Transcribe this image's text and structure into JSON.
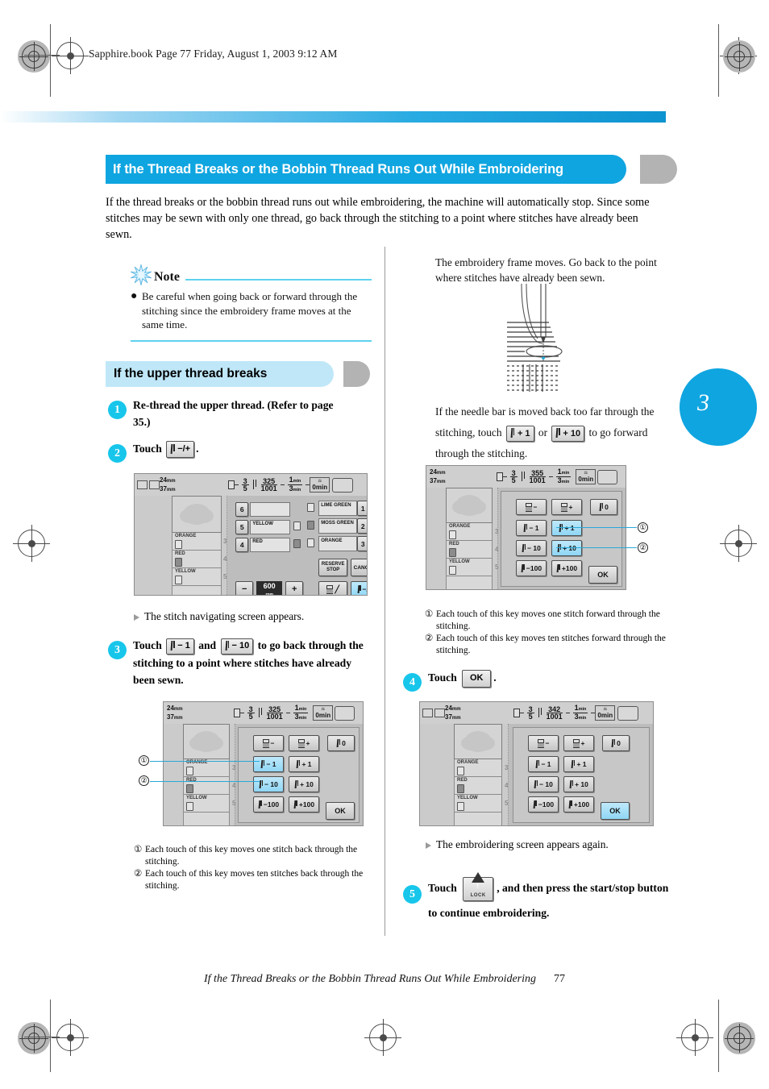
{
  "runhead": "Sapphire.book  Page 77  Friday, August 1, 2003  9:12 AM",
  "title": "If the Thread Breaks or the Bobbin Thread Runs Out While Embroidering",
  "intro": "If the thread breaks or the bobbin thread runs out while embroidering, the machine will automatically stop. Since some stitches may be sewn with only one thread, go back through the stitching to a point where stitches have already been sewn.",
  "note": {
    "title": "Note",
    "bullet": "●",
    "text": "Be careful when going back or forward through the stitching since the embroidery frame moves at the same time."
  },
  "subhead": "If the upper thread breaks",
  "chapter_tab": "3",
  "steps": {
    "s1": {
      "num": "1",
      "text": "Re-thread the upper thread. (Refer to page 35.)"
    },
    "s2": {
      "num": "2",
      "pre": "Touch",
      "key": "−/+",
      "post": "."
    },
    "s2_result": "The stitch navigating screen appears.",
    "s3": {
      "num": "3",
      "pre": "Touch",
      "key1": "− 1",
      "mid": "and",
      "key2": "− 10",
      "post": "to go back through the stitching to a point where stitches have already been sewn."
    },
    "s4": {
      "num": "4",
      "pre": "Touch",
      "key": "OK",
      "post": "."
    },
    "s4_result": "The embroidering screen appears again.",
    "s5": {
      "num": "5",
      "pre": "Touch",
      "key_label": "LOCK",
      "post": ", and then press the start/stop button to continue embroidering."
    }
  },
  "right_col": {
    "frame_moves": "The embroidery frame moves. Go back to the point where stitches have already been sewn.",
    "too_far_pre": "If the needle bar is moved back too far through the stitching, touch",
    "too_far_key1": "+ 1",
    "too_far_or": "or",
    "too_far_key2": "+ 10",
    "too_far_post": "to go forward through the stitching."
  },
  "captions": {
    "back": [
      {
        "num": "①",
        "text": "Each touch of this key moves one stitch back through the stitching."
      },
      {
        "num": "②",
        "text": "Each touch of this key moves ten stitches back through the stitching."
      }
    ],
    "forward": [
      {
        "num": "①",
        "text": "Each touch of this key moves one stitch forward through the stitching."
      },
      {
        "num": "②",
        "text": "Each touch of this key moves ten stitches forward through the stitching."
      }
    ]
  },
  "lcd_common": {
    "width_mm": "24",
    "height_mm": "37",
    "mm_unit": "mm",
    "color_num": "3",
    "color_den": "5",
    "stitch_den": "1001",
    "time_a": "1",
    "time_b": "3",
    "time_unit": "min",
    "timer": "0",
    "timer_unit": "min",
    "threads": [
      {
        "name": "ORANGE",
        "num": "3"
      },
      {
        "name": "RED",
        "num": "4"
      },
      {
        "name": "YELLOW",
        "num": "5"
      }
    ]
  },
  "lcd1": {
    "stitch_num": "325",
    "bar_rows": [
      {
        "slot": "6",
        "color": ""
      },
      {
        "slot": "5",
        "color": "YELLOW"
      },
      {
        "slot": "4",
        "color": "RED"
      }
    ],
    "right_rows": [
      {
        "color": "LIME GREEN",
        "num": "1"
      },
      {
        "color": "MOSS GREEN",
        "num": "2"
      },
      {
        "color": "ORANGE",
        "num": "3"
      }
    ],
    "reserve_stop": "RESERVE STOP",
    "cancel": "CANCEL",
    "speed": "600",
    "speed_unit": "rpm",
    "minus": "−",
    "plus": "+",
    "navkey": "−/+"
  },
  "lcd2": {
    "stitch_num": "325",
    "keys": [
      {
        "label": "−",
        "type": "bobbin",
        "hl": false
      },
      {
        "label": "+",
        "type": "bobbin",
        "hl": false
      },
      {
        "label": "0",
        "type": "needle",
        "hl": false
      },
      {
        "label": "− 1",
        "type": "needle",
        "hl": true
      },
      {
        "label": "+ 1",
        "type": "needle",
        "hl": false
      },
      {
        "label": "− 10",
        "type": "needle",
        "hl": true
      },
      {
        "label": "+ 10",
        "type": "needle",
        "hl": false
      },
      {
        "label": "−100",
        "type": "needle",
        "hl": false
      },
      {
        "label": "+100",
        "type": "needle",
        "hl": false
      }
    ],
    "ok": "OK"
  },
  "lcd3": {
    "stitch_num": "355",
    "keys": [
      {
        "label": "−",
        "type": "bobbin",
        "hl": false
      },
      {
        "label": "+",
        "type": "bobbin",
        "hl": false
      },
      {
        "label": "0",
        "type": "needle",
        "hl": false
      },
      {
        "label": "− 1",
        "type": "needle",
        "hl": false
      },
      {
        "label": "+ 1",
        "type": "needle",
        "hl": true
      },
      {
        "label": "− 10",
        "type": "needle",
        "hl": false
      },
      {
        "label": "+ 10",
        "type": "needle",
        "hl": true
      },
      {
        "label": "−100",
        "type": "needle",
        "hl": false
      },
      {
        "label": "+100",
        "type": "needle",
        "hl": false
      }
    ],
    "ok": "OK"
  },
  "lcd4": {
    "stitch_num": "342",
    "keys": [
      {
        "label": "−",
        "type": "bobbin",
        "hl": false
      },
      {
        "label": "+",
        "type": "bobbin",
        "hl": false
      },
      {
        "label": "0",
        "type": "needle",
        "hl": false
      },
      {
        "label": "− 1",
        "type": "needle",
        "hl": false
      },
      {
        "label": "+ 1",
        "type": "needle",
        "hl": false
      },
      {
        "label": "− 10",
        "type": "needle",
        "hl": false
      },
      {
        "label": "+ 10",
        "type": "needle",
        "hl": false
      },
      {
        "label": "−100",
        "type": "needle",
        "hl": false
      },
      {
        "label": "+100",
        "type": "needle",
        "hl": false
      }
    ],
    "ok": "OK",
    "ok_hl": true
  },
  "footer": {
    "text": "If the Thread Breaks or the Bobbin Thread Runs Out While Embroidering",
    "page": "77"
  },
  "colors": {
    "accent": "#0fa5e0",
    "step": "#17c6ea",
    "subhead_bg": "#bfe7f8",
    "highlight": "#8fd6f5"
  }
}
